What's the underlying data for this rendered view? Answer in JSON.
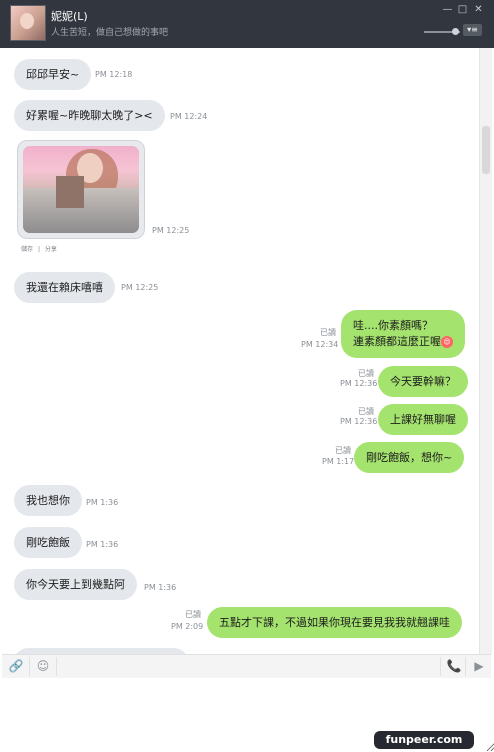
{
  "window": {
    "contact_name": "妮妮(L)",
    "status_message": "人生苦短，做自己想做的事吧",
    "buttons": {
      "minimize": "—",
      "maximize": "□",
      "close": "✕",
      "menu": "▾≡"
    }
  },
  "messages": [
    {
      "dir": "in",
      "text": "邱邱早安~",
      "time": "PM 12:18"
    },
    {
      "dir": "in",
      "text": "好累喔~昨晚聊太晚了><",
      "time": "PM 12:24"
    },
    {
      "dir": "in",
      "type": "image",
      "time": "PM 12:25",
      "actions": [
        "儲存",
        "分享"
      ]
    },
    {
      "dir": "in",
      "text": "我還在賴床嘻嘻",
      "time": "PM 12:25"
    },
    {
      "dir": "out",
      "lines": [
        "哇....你素顏嗎？",
        "連素顏都這麼正喔"
      ],
      "emoji": "😍",
      "read": "已讀",
      "time": "PM 12:34"
    },
    {
      "dir": "out",
      "text": "今天要幹嘛？",
      "read": "已讀",
      "time": "PM 12:36"
    },
    {
      "dir": "out",
      "text": "上課好無聊喔",
      "read": "已讀",
      "time": "PM 12:36"
    },
    {
      "dir": "out",
      "text": "剛吃飽飯，想你~",
      "read": "已讀",
      "time": "PM 1:17"
    },
    {
      "dir": "in",
      "text": "我也想你",
      "time": "PM 1:36"
    },
    {
      "dir": "in",
      "text": "剛吃飽飯",
      "time": "PM 1:36"
    },
    {
      "dir": "in",
      "text": "你今天要上到幾點阿",
      "time": "PM 1:36"
    },
    {
      "dir": "out",
      "text": "五點才下課，不過如果你現在要見我我就翹課哇",
      "read": "已讀",
      "time": "PM 2:09"
    }
  ],
  "toolbar": {
    "attach_icon": "🔗",
    "emoji_icon": "☺",
    "call_icon": "📞",
    "video_icon": "▶"
  },
  "watermark": "funpeer.com"
}
